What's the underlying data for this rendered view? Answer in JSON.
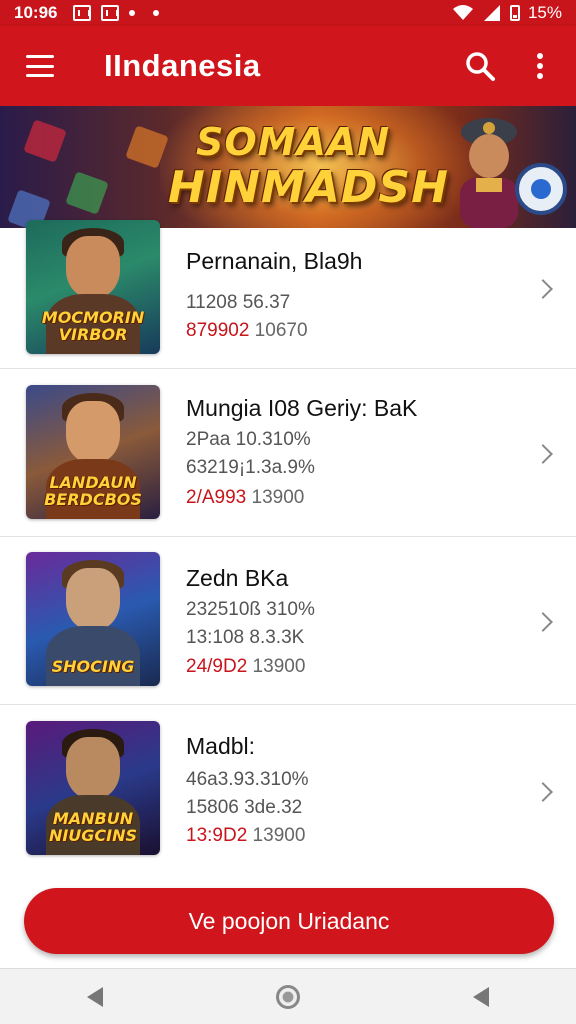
{
  "status_bar": {
    "time": "10:96",
    "battery": "15%"
  },
  "app_bar": {
    "title": "IIndanesia"
  },
  "banner": {
    "line1": "SOMAAN",
    "line2": "HINMADSH"
  },
  "items": [
    {
      "title": "Pernanain, Bla9h",
      "line1": "11208 56.37",
      "line2_red": "879902",
      "line2_rest": " 10670",
      "line3": "",
      "thumb_caption": "MOCMORIN VIRBOR"
    },
    {
      "title": "Mungia I08 Geriy: BaK",
      "line1": "2Paa 10.310%",
      "line2": "63219¡1.3a.9%",
      "line3_red": "2/A993",
      "line3_rest": " 13900",
      "thumb_caption": "LANDAUN BERDCBOS"
    },
    {
      "title": "Zedn BKa",
      "line1": "232510ß 310%",
      "line2": "13:108 8.3.3K",
      "line3_red": "24/9D2",
      "line3_rest": " 13900",
      "thumb_caption": "SHOCING"
    },
    {
      "title": "Madbl:",
      "line1": "46a3.93.310%",
      "line2": "15806 3de.32",
      "line3_red": "13:9D2",
      "line3_rest": " 13900",
      "thumb_caption": "MANBUN NIUGCINS"
    }
  ],
  "cta": {
    "label": "Ve poojon Uriadanc"
  },
  "colors": {
    "primary": "#d0161c",
    "accent_red": "#c8141b"
  }
}
